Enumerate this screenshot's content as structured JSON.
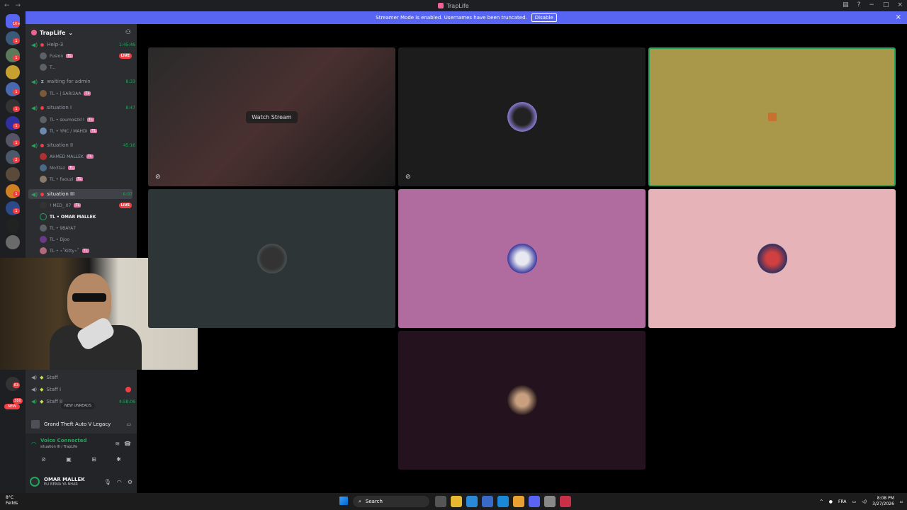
{
  "window": {
    "title": "TrapLife",
    "controls": [
      "−",
      "□",
      "×"
    ]
  },
  "banner": {
    "message": "Streamer Mode is enabled. Usernames have been truncated.",
    "disable_label": "Disable"
  },
  "server": {
    "name": "TrapLife",
    "chevron": "⌄",
    "channels": [
      {
        "name": "Help-3",
        "time": "1:45:46"
      },
      {
        "name": "waiting for admin",
        "time": "8:33"
      },
      {
        "name": "situation I",
        "time": "8:47"
      },
      {
        "name": "situation II",
        "time": "45:16"
      },
      {
        "name": "situation III",
        "time": "6:07"
      }
    ],
    "users": [
      {
        "name": "Fusion",
        "tag": "TL",
        "live": "LIVE"
      },
      {
        "name": "T...",
        "tag": "",
        "live": ""
      },
      {
        "name": "TL • | SARI3AA",
        "tag": "TL",
        "live": ""
      },
      {
        "name": "TL • soumoszk!!",
        "tag": "TL",
        "live": ""
      },
      {
        "name": "TL • YMC / MAHDI",
        "tag": "TL",
        "live": ""
      },
      {
        "name": "AHMED MALLEK",
        "tag": "TL",
        "live": ""
      },
      {
        "name": "Mo3taz",
        "tag": "TL",
        "live": ""
      },
      {
        "name": "TL • Faouzi",
        "tag": "TL",
        "live": ""
      },
      {
        "name": "! MED_ 07",
        "tag": "TL",
        "live": "LIVE"
      },
      {
        "name": "TL • OMAR MALLEK",
        "tag": "TL",
        "live": ""
      },
      {
        "name": "TL • 9BAYA7",
        "tag": "",
        "live": ""
      },
      {
        "name": "TL • Djoo",
        "tag": "",
        "live": ""
      },
      {
        "name": "TL • ⋆˚Kitty⋆˚",
        "tag": "TL",
        "live": ""
      }
    ],
    "staff": [
      {
        "name": "Staff",
        "time": ""
      },
      {
        "name": "Staff I",
        "time": ""
      },
      {
        "name": "Staff II",
        "time": "4:58:06"
      }
    ],
    "new_unreads": "NEW UNREADS"
  },
  "activity": {
    "game": "Grand Theft Auto V Legacy"
  },
  "voice": {
    "status": "Voice Connected",
    "location": "situation III / TrapLife"
  },
  "user_panel": {
    "name": "OMAR MALLEK",
    "status": "ELI BEINA YA NHAR"
  },
  "stage": {
    "watch_stream": "Watch Stream"
  },
  "taskbar": {
    "weather_temp": "8°C",
    "weather_desc": "Fellds",
    "search_label": "Search",
    "lang": "FRA",
    "time": "8:08 PM",
    "date": "3/27/2026"
  },
  "rail_badges": [
    "1K+",
    "1",
    "1",
    "1",
    "1",
    "1",
    "1",
    "2",
    "1",
    "1",
    "83",
    "386"
  ],
  "new_badge": "NEW"
}
